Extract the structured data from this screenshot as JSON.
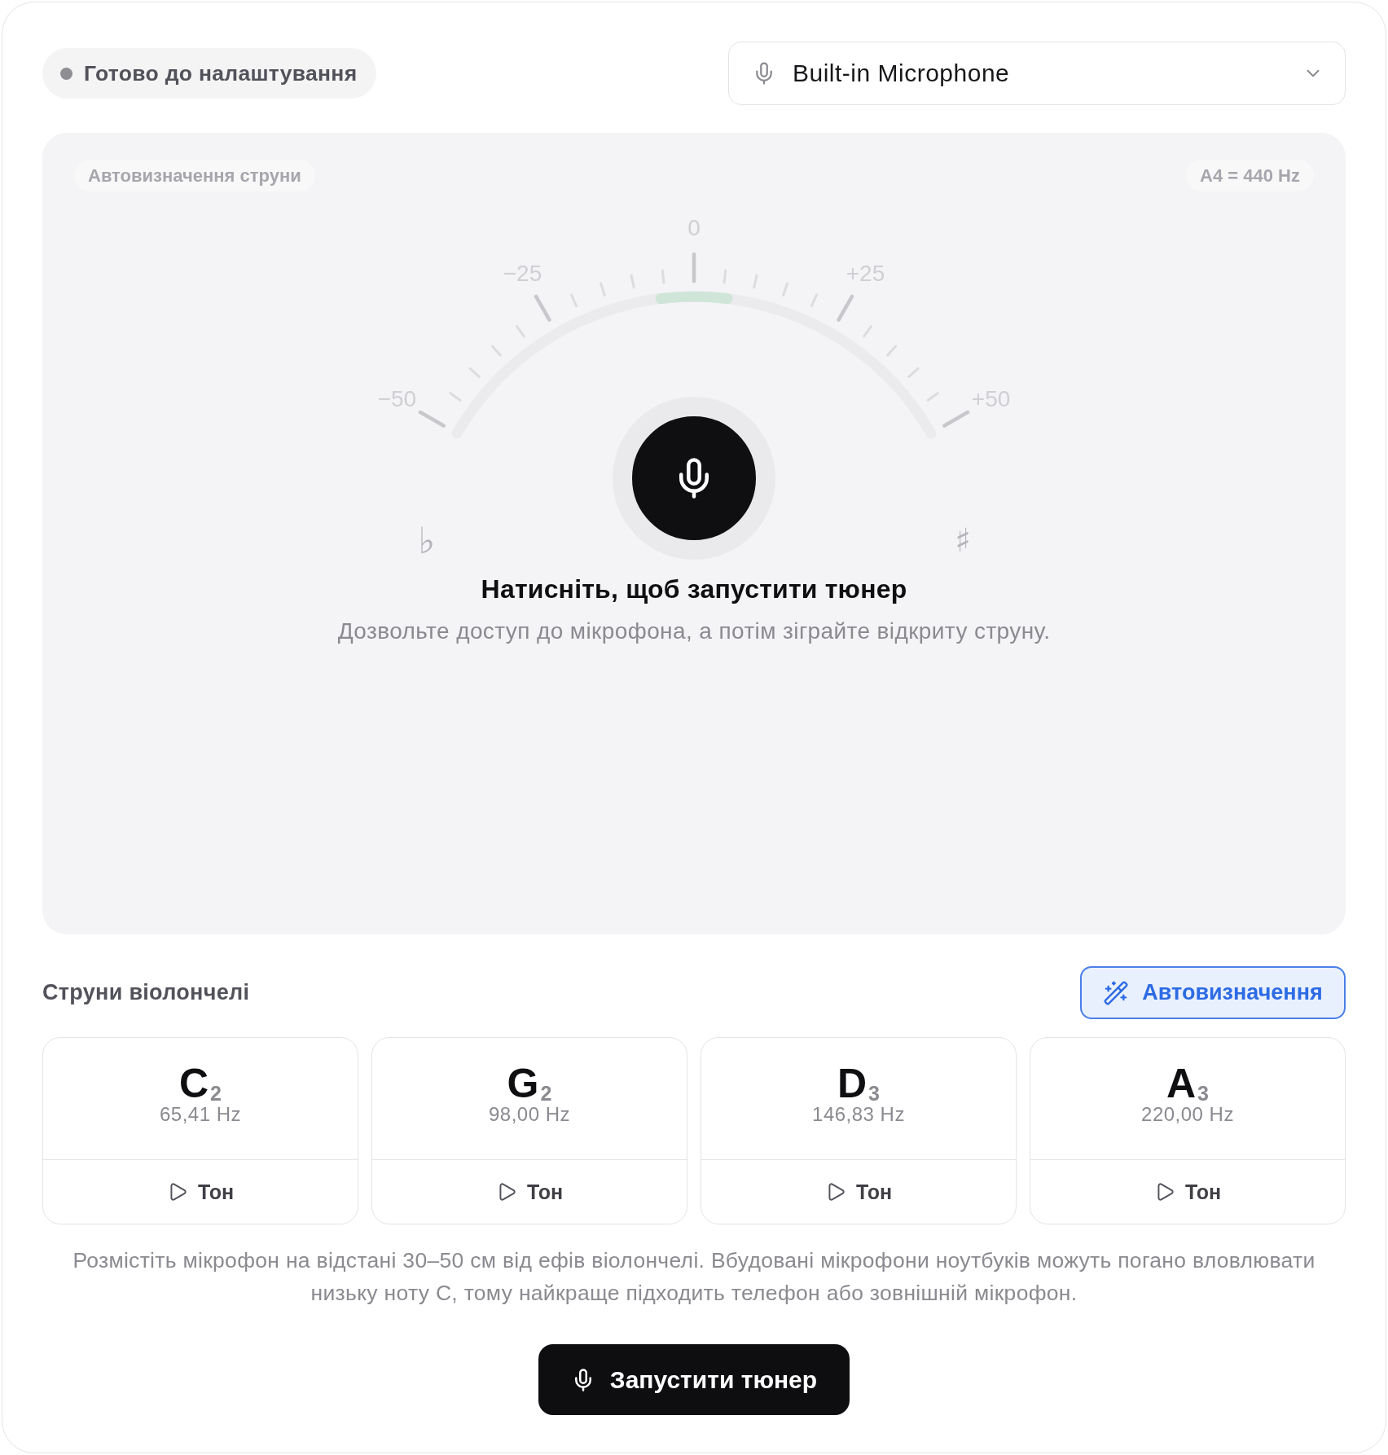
{
  "status": {
    "label": "Готово до налаштування"
  },
  "device_select": {
    "value": "Built-in Microphone"
  },
  "tuner": {
    "mode_chip": "Автовизначення струни",
    "reference_chip": "A4 = 440 Hz",
    "scale_labels": [
      "−50",
      "−25",
      "0",
      "+25",
      "+50"
    ],
    "flat_symbol": "♭",
    "sharp_symbol": "♯",
    "prompt_title": "Натисніть, щоб запустити тюнер",
    "prompt_text": "Дозвольте доступ до мікрофона, а потім зіграйте відкриту струну."
  },
  "strings": {
    "title": "Струни віолончелі",
    "auto_detect": {
      "label": "Автовизначення",
      "on": true
    },
    "items": [
      {
        "note": "C",
        "octave": "2",
        "frequency": "65,41 Hz",
        "tone_button": "Тон"
      },
      {
        "note": "G",
        "octave": "2",
        "frequency": "98,00 Hz",
        "tone_button": "Тон"
      },
      {
        "note": "D",
        "octave": "3",
        "frequency": "146,83 Hz",
        "tone_button": "Тон"
      },
      {
        "note": "A",
        "octave": "3",
        "frequency": "220,00 Hz",
        "tone_button": "Тон"
      }
    ]
  },
  "hint": "Розмістіть мікрофон на відстані 30–50 см від ефів віолончелі. Вбудовані мікрофони ноутбуків можуть погано вловлювати низьку ноту C, тому найкраще підходить телефон або зовнішній мікрофон.",
  "start_button": {
    "label": "Запустити тюнер"
  }
}
